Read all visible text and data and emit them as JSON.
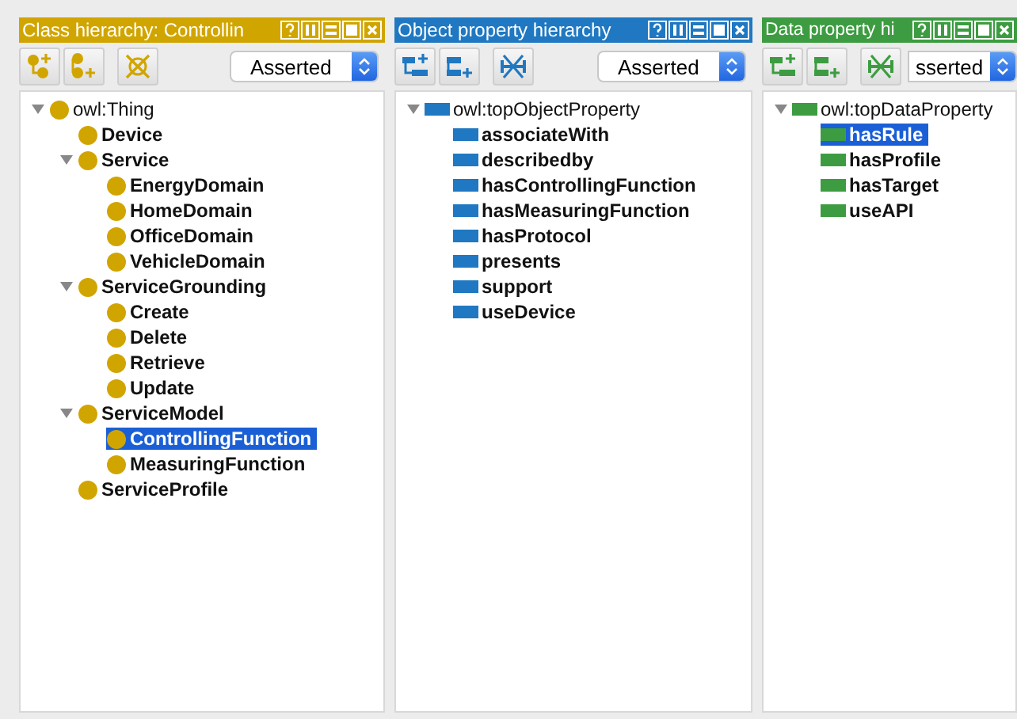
{
  "panels": [
    {
      "kind": "class",
      "color": "#d1a500",
      "title": "Class hierarchy: Controllin",
      "view": "Asserted",
      "tree": [
        {
          "label": "owl:Thing",
          "expanded": true,
          "selected": false,
          "children": [
            {
              "label": "Device",
              "selected": false
            },
            {
              "label": "Service",
              "expanded": true,
              "selected": false,
              "children": [
                {
                  "label": "EnergyDomain",
                  "selected": false
                },
                {
                  "label": "HomeDomain",
                  "selected": false
                },
                {
                  "label": "OfficeDomain",
                  "selected": false
                },
                {
                  "label": "VehicleDomain",
                  "selected": false
                }
              ]
            },
            {
              "label": "ServiceGrounding",
              "expanded": true,
              "selected": false,
              "children": [
                {
                  "label": "Create",
                  "selected": false
                },
                {
                  "label": "Delete",
                  "selected": false
                },
                {
                  "label": "Retrieve",
                  "selected": false
                },
                {
                  "label": "Update",
                  "selected": false
                }
              ]
            },
            {
              "label": "ServiceModel",
              "expanded": true,
              "selected": false,
              "children": [
                {
                  "label": "ControllingFunction",
                  "selected": true
                },
                {
                  "label": "MeasuringFunction",
                  "selected": false
                }
              ]
            },
            {
              "label": "ServiceProfile",
              "selected": false
            }
          ]
        }
      ]
    },
    {
      "kind": "object",
      "color": "#1f78c1",
      "title": "Object property hierarchy",
      "view": "Asserted",
      "tree": [
        {
          "label": "owl:topObjectProperty",
          "expanded": true,
          "selected": false,
          "children": [
            {
              "label": "associateWith",
              "selected": false
            },
            {
              "label": "describedby",
              "selected": false
            },
            {
              "label": "hasControllingFunction",
              "selected": false
            },
            {
              "label": "hasMeasuringFunction",
              "selected": false
            },
            {
              "label": "hasProtocol",
              "selected": false
            },
            {
              "label": "presents",
              "selected": false
            },
            {
              "label": "support",
              "selected": false
            },
            {
              "label": "useDevice",
              "selected": false
            }
          ]
        }
      ]
    },
    {
      "kind": "data",
      "color": "#3d9c41",
      "title": "Data property hi",
      "view": "sserted",
      "tree": [
        {
          "label": "owl:topDataProperty",
          "expanded": true,
          "selected": false,
          "children": [
            {
              "label": "hasRule",
              "selected": true
            },
            {
              "label": "hasProfile",
              "selected": false
            },
            {
              "label": "hasTarget",
              "selected": false
            },
            {
              "label": "useAPI",
              "selected": false
            }
          ]
        }
      ]
    }
  ]
}
